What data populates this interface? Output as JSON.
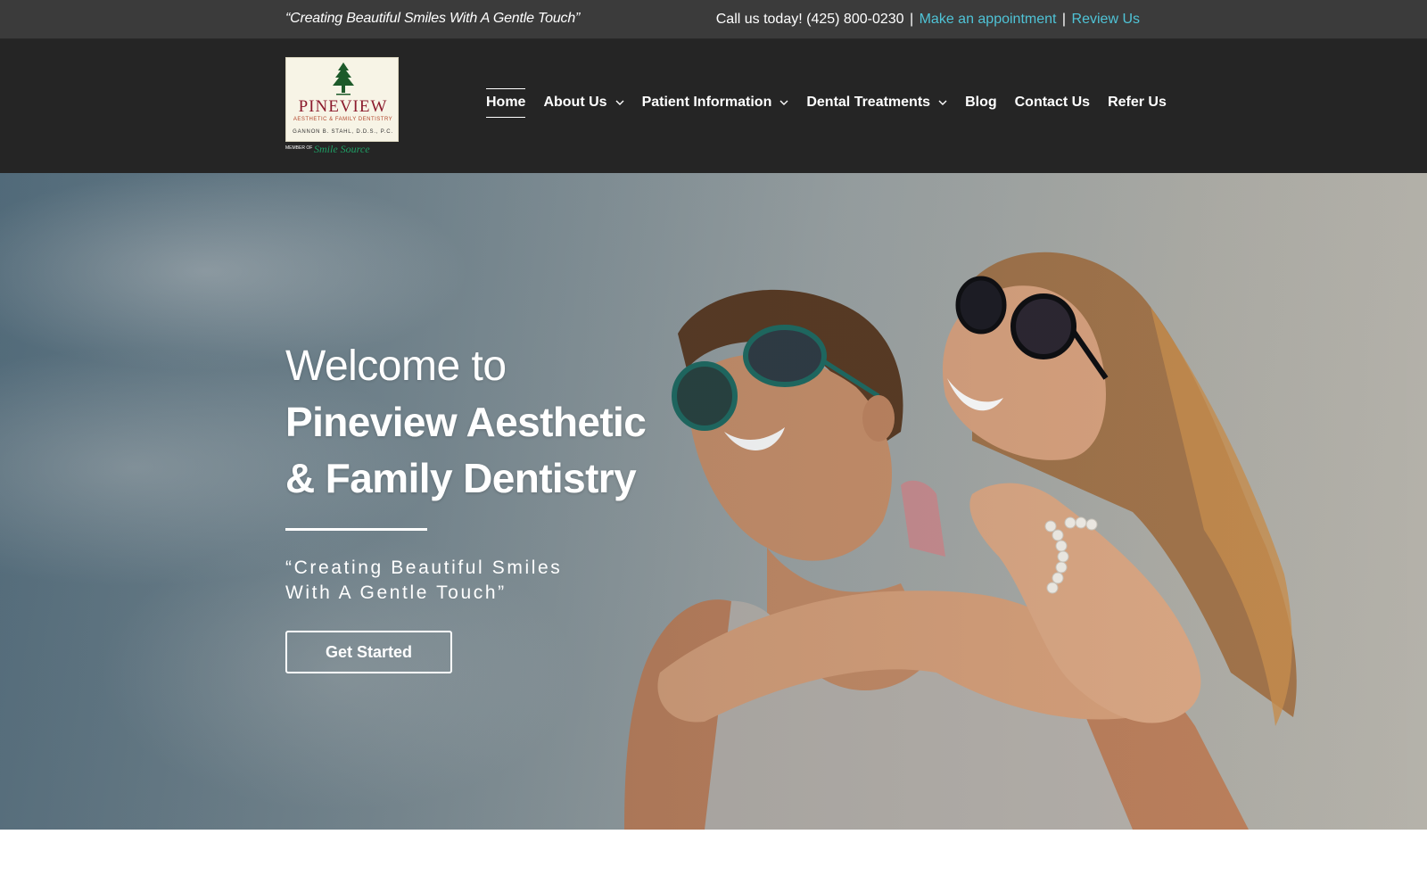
{
  "topbar": {
    "tagline": "“Creating Beautiful Smiles With A Gentle Touch”",
    "call_text": "Call us today! (425) 800-0230",
    "separator": "|",
    "appointment_link": "Make an appointment",
    "review_link": "Review Us",
    "link_color": "#4fc3d6"
  },
  "logo": {
    "name": "PINEVIEW",
    "subtitle": "AESTHETIC & FAMILY DENTISTRY",
    "doctor": "GANNON B. STAHL, D.D.S., P.C.",
    "member_text": "MEMBER OF",
    "network": "Smile Source",
    "brand_color": "#8c1c2e"
  },
  "nav": {
    "items": [
      {
        "label": "Home",
        "active": true,
        "has_dropdown": false
      },
      {
        "label": "About Us",
        "active": false,
        "has_dropdown": true
      },
      {
        "label": "Patient Information",
        "active": false,
        "has_dropdown": true
      },
      {
        "label": "Dental Treatments",
        "active": false,
        "has_dropdown": true
      },
      {
        "label": "Blog",
        "active": false,
        "has_dropdown": false
      },
      {
        "label": "Contact Us",
        "active": false,
        "has_dropdown": false
      },
      {
        "label": "Refer Us",
        "active": false,
        "has_dropdown": false
      }
    ],
    "dropdown_icon": "chevron-down-icon"
  },
  "hero": {
    "welcome": "Welcome to",
    "practice_line1": "Pineview Aesthetic",
    "practice_line2": "& Family Dentistry",
    "slogan_line1": "“Creating Beautiful Smiles",
    "slogan_line2": "With A Gentle Touch”",
    "cta_label": "Get Started"
  }
}
